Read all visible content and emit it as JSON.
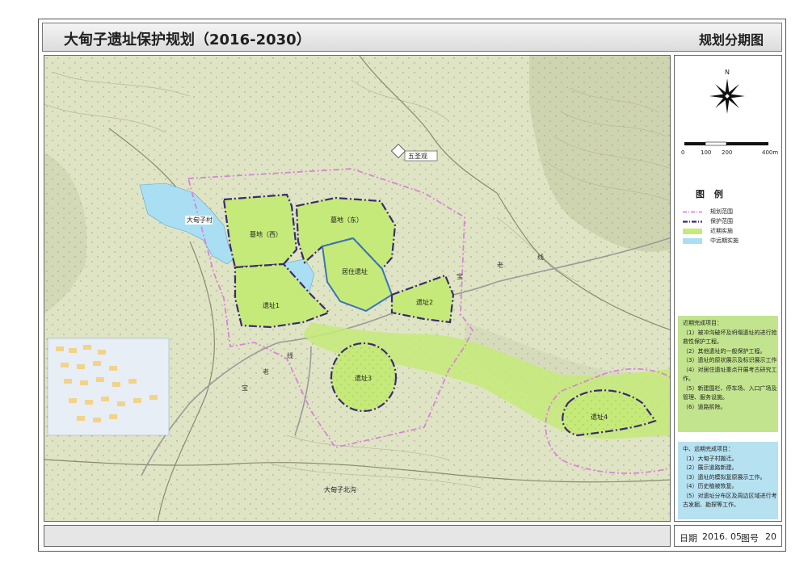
{
  "header": {
    "title": "大甸子遗址保护规划（2016-2030）",
    "sheet_name": "规划分期图"
  },
  "map": {
    "labels": {
      "village": "大甸子村",
      "cemetery_west": "墓地（西）",
      "cemetery_east": "墓地（东）",
      "residence": "居住遗址",
      "site1": "遗址1",
      "site2": "遗址2",
      "site3": "遗址3",
      "site4": "遗址4",
      "wushengguan": "五圣观",
      "north_gully": "大甸子北沟",
      "road_chars": [
        "宝",
        "老",
        "线"
      ]
    },
    "compass": {
      "north": "N"
    },
    "scale_bar": {
      "ticks": [
        "0",
        "100",
        "200",
        "400m"
      ]
    }
  },
  "legend": {
    "title": "图 例",
    "items": [
      {
        "label": "规划范围",
        "swatch": "plan-boundary"
      },
      {
        "label": "保护范围",
        "swatch": "protect-boundary"
      },
      {
        "label": "近期实施",
        "swatch": "near-term-fill"
      },
      {
        "label": "中远期实施",
        "swatch": "long-term-fill"
      }
    ]
  },
  "near_term": {
    "title": "近期完成项目：",
    "items": [
      "（1）被冲沟破坏及坍塌遗址的进行抢",
      "救性保护工程。",
      "（2）其他遗址的一般保护工程。",
      "（3）遗址的原状展示及标识展示工作",
      "（4）对居住遗址重点开展考古研究工",
      "作。",
      "（5）新建围栏、停车场、入口广场及",
      "管理、服务设施。",
      "（6）道路拆除。"
    ]
  },
  "long_term": {
    "title": "中、远期完成项目：",
    "items": [
      "（1）大甸子村搬迁。",
      "（2）展示道路新建。",
      "（3）遗址的模拟复原展示工作。",
      "（4）历史植被恢复。",
      "（5）对遗址分布区及周边区域进行考",
      "古发掘、勘探等工作。"
    ]
  },
  "footer": {
    "date_label": "日期",
    "date_value": "2016. 05",
    "number_label": "图号",
    "number_value": "20"
  },
  "colors": {
    "terrain": "#dfe4c4",
    "near_term": "#c6ea7a",
    "long_term": "#9fdcf0",
    "plan_boundary": "#d884d8",
    "protect_boundary": "#3b2a72",
    "near_panel": "#c3e48e",
    "far_panel": "#b6e1f0"
  }
}
